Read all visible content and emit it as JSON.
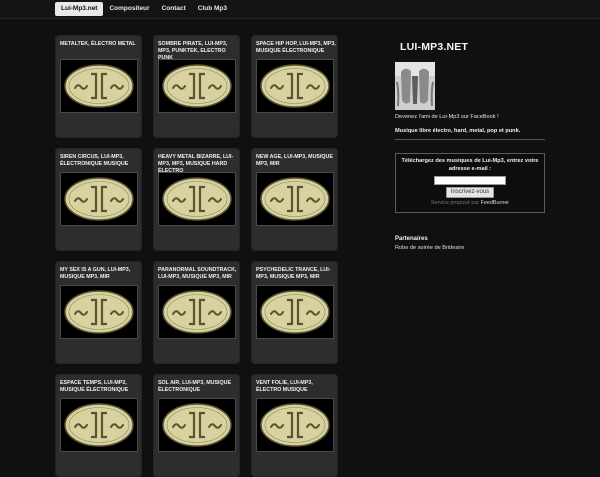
{
  "nav": {
    "items": [
      {
        "label": "Lui-Mp3.net",
        "active": true
      },
      {
        "label": "Compositeur",
        "active": false
      },
      {
        "label": "Contact",
        "active": false
      },
      {
        "label": "Club Mp3",
        "active": false
      }
    ]
  },
  "cards": [
    {
      "title": "METALTEK, ÉLECTRO METAL"
    },
    {
      "title": "SOMBRE PIRATE, LUI-MP3, MP3, PUNKTEK, ELECTRO PUNK"
    },
    {
      "title": "SPACE HIP HOP, LUI-MP3, MP3, MUSIQUE ÉLECTRONIQUE"
    },
    {
      "title": "SIREN CIRCUS, LUI-MP3, ÉLECTRONIQUE MUSIQUE"
    },
    {
      "title": "HEAVY METAL BIZARRE, LUI-MP3, MP3, MUSIQUE HARD ÉLECTRO"
    },
    {
      "title": "NEW AGE, LUI-MP3, MUSIQUE MP3, MIR"
    },
    {
      "title": "MY SEX IS A GUN, LUI-MP3, MUSIQUE MP3, MIR"
    },
    {
      "title": "PARANORMAL SOUNDTRACK, LUI-MP3, MUSIQUE MP3, MIR"
    },
    {
      "title": "PSYCHEDELIC TRANCE, LUI-MP3, MUSIQUE MP3, MIR"
    },
    {
      "title": "ESPACE TEMPS, LUI-MP3, MUSIQUE ÉLECTRONIQUE"
    },
    {
      "title": "SOL AIR, LUI-MP3, MUSIQUE ÉLECTRONIQUE"
    },
    {
      "title": "VENT FOLIE, LUI-MP3, ÉLECTRO MUSIQUE"
    }
  ],
  "sidebar": {
    "site_title": "LUI-MP3.NET",
    "fb_text": "Devenez l'ami de Lui-Mp3 sur FaceBook !",
    "tagline": "Musique libre électro, hard, metal, pop et punk.",
    "subscribe": {
      "label": "Téléchargez des musiques de Lui-Mp3, entrez votre adresse e-mail :",
      "input_value": "",
      "button": "Inscrivez-vous",
      "service_prefix": "Service proposé par",
      "service_name": "FeedBurner"
    },
    "partners_title": "Partenaires",
    "partners_link": "Robe de soirée de Bridesire"
  },
  "colors": {
    "background": "#101010",
    "card": "#2d2d2d",
    "logo_fill": "#d8d2a0",
    "logo_stroke": "#5a5430"
  },
  "icons": {
    "card_image": "lui-mp3-logo-icon",
    "avatar": "lui-mp3-avatar"
  }
}
